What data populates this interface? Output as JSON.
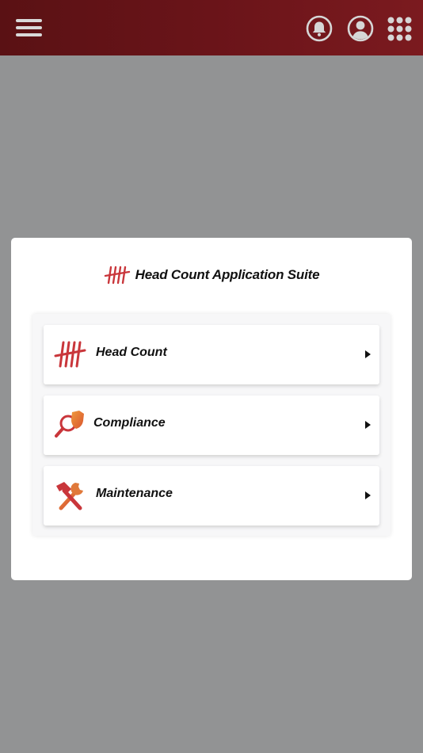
{
  "header": {
    "menu_icon": "hamburger-menu-icon",
    "notifications_icon": "bell-icon",
    "profile_icon": "user-circle-icon",
    "apps_icon": "app-grid-icon",
    "bar_color": "#6a1419"
  },
  "dialog": {
    "title": "Head Count Application Suite",
    "logo_icon": "tally-marks-icon",
    "apps": [
      {
        "label": "Head Count",
        "icon": "tally-marks-icon"
      },
      {
        "label": "Compliance",
        "icon": "magnifier-shield-icon"
      },
      {
        "label": "Maintenance",
        "icon": "hammer-wrench-icon"
      }
    ]
  },
  "colors": {
    "accent_red": "#c9363b",
    "accent_orange": "#e0793a",
    "backdrop": "#929394"
  }
}
